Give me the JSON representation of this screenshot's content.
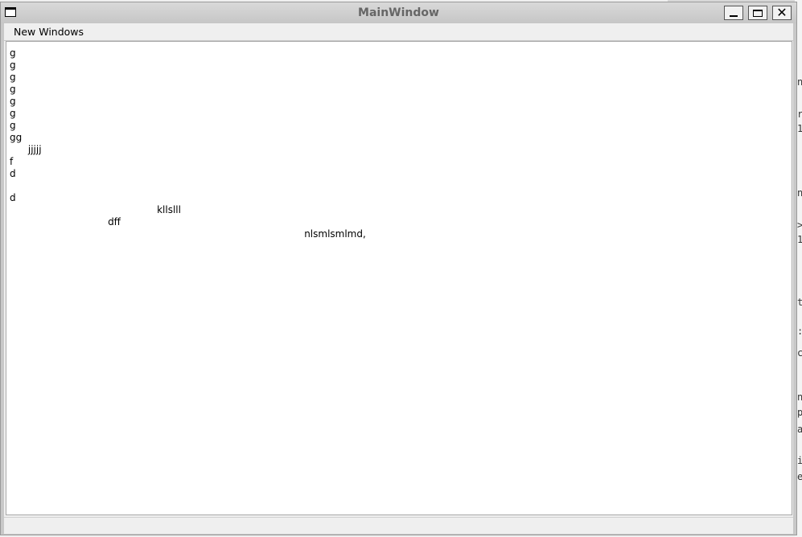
{
  "window": {
    "title": "MainWindow",
    "menu_icon": "window-menu-icon",
    "controls": {
      "minimize_icon": "minimize-icon",
      "maximize_icon": "maximize-icon",
      "close_glyph": "✕"
    }
  },
  "menubar": {
    "items": [
      {
        "label": "New Windows"
      }
    ]
  },
  "editor": {
    "lines": [
      "g",
      "g",
      "g",
      "g",
      "g",
      "g",
      "g",
      "gg",
      "      jjjjj",
      "f",
      "d",
      "",
      "d",
      "                                                kllslll",
      "                                dff",
      "                                                                                                nlsmlsmlmd,"
    ]
  },
  "background": {
    "edge_chars": [
      "n",
      "r",
      "1",
      "n",
      ">",
      "1",
      "t",
      ":",
      "c",
      "n",
      "p",
      "a",
      "i",
      "e"
    ]
  }
}
